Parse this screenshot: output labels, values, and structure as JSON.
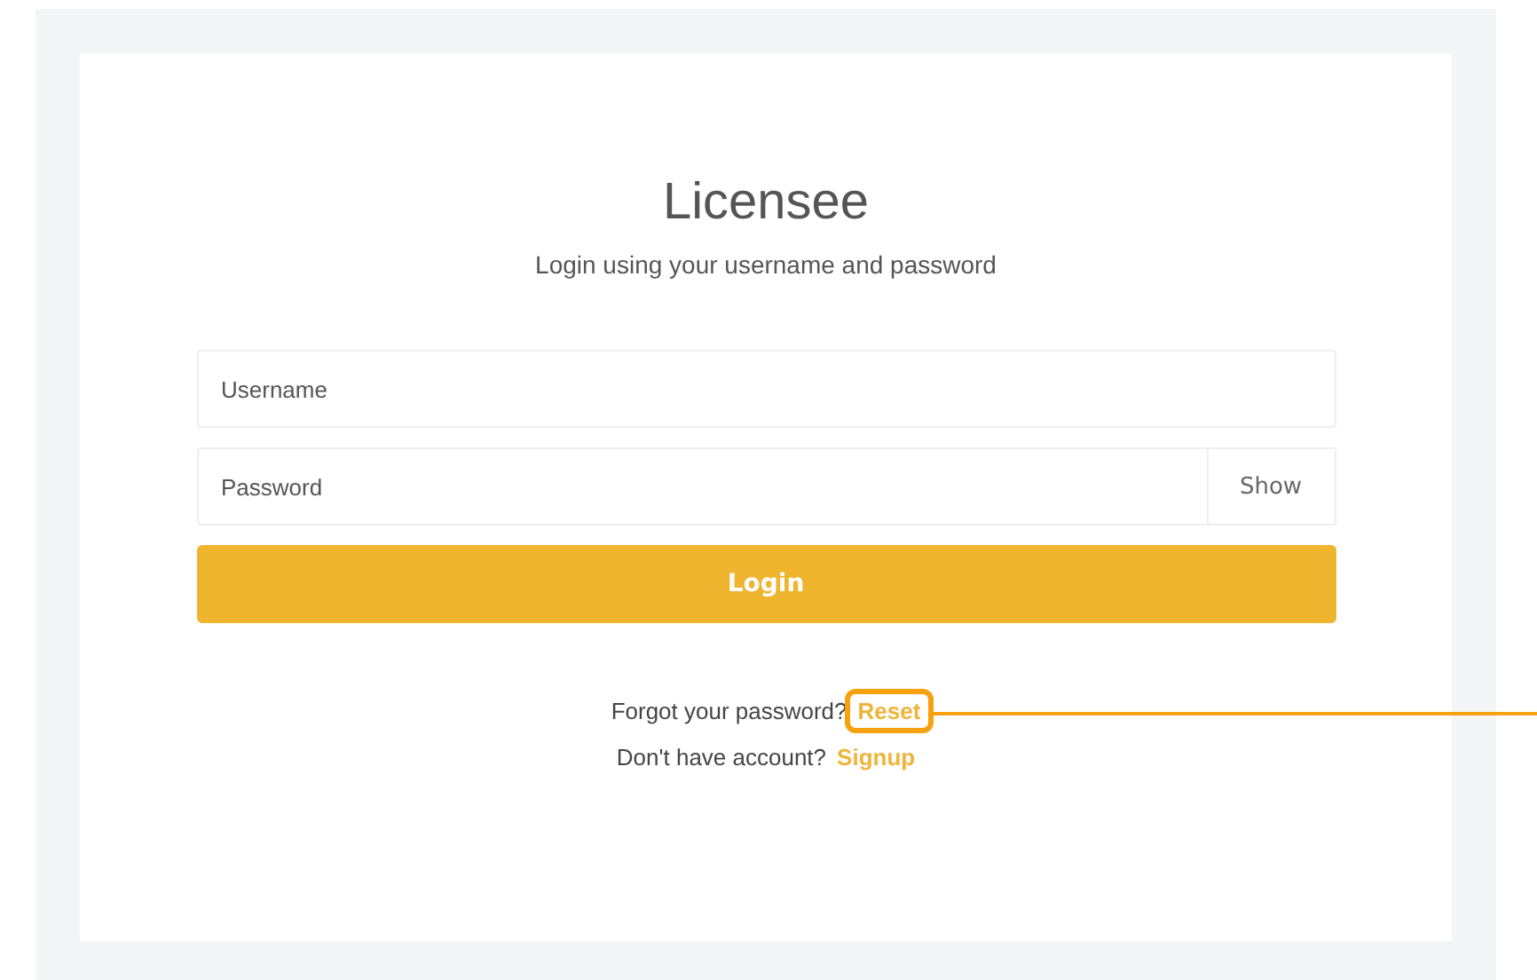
{
  "title": "Licensee",
  "subtitle": "Login using your username and password",
  "username_field": {
    "placeholder": "Username"
  },
  "password_field": {
    "placeholder": "Password",
    "toggle": "Show"
  },
  "login_button": "Login",
  "links": [
    {
      "prompt": "Forgot your password?",
      "link": "Reset",
      "highlighted": true
    },
    {
      "prompt": "Don't have account?",
      "link": "Signup",
      "highlighted": false
    }
  ]
}
